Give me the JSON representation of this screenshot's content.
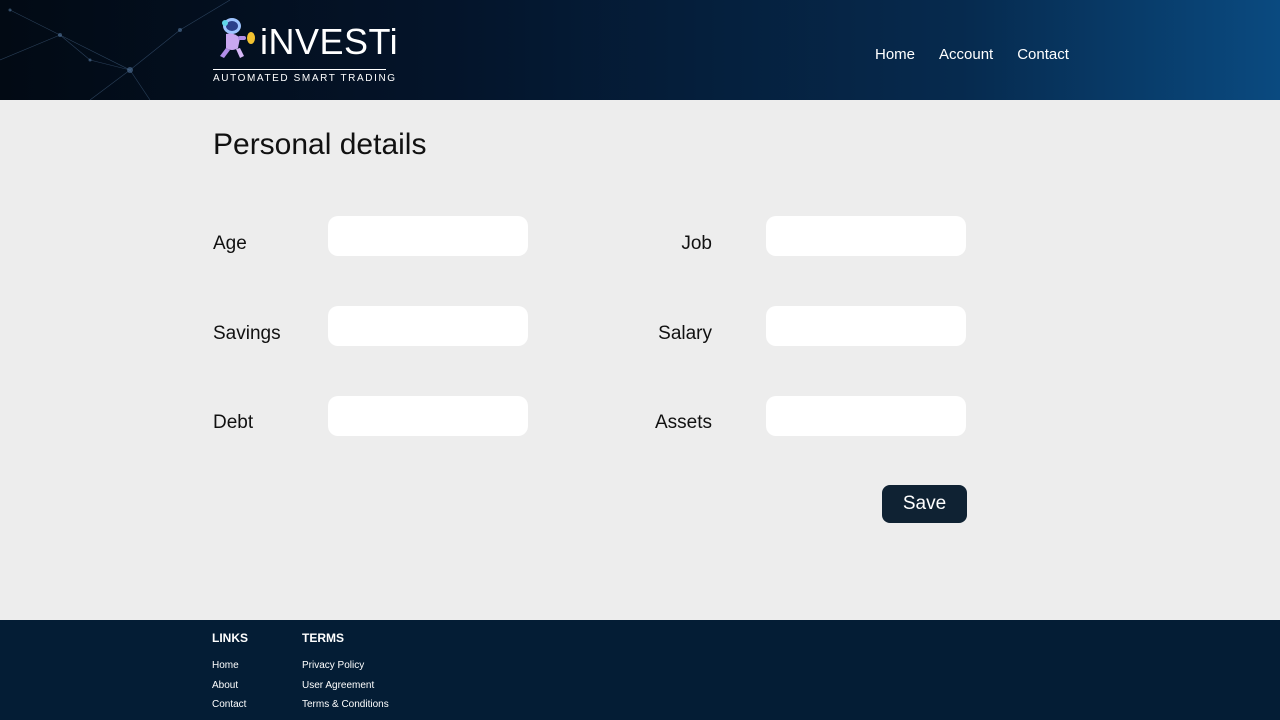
{
  "header": {
    "brand": "iNVESTi",
    "tagline": "AUTOMATED SMART TRADING",
    "nav": [
      "Home",
      "Account",
      "Contact"
    ]
  },
  "main": {
    "title": "Personal details",
    "fields": {
      "age": {
        "label": "Age",
        "value": ""
      },
      "job": {
        "label": "Job",
        "value": ""
      },
      "savings": {
        "label": "Savings",
        "value": ""
      },
      "salary": {
        "label": "Salary",
        "value": ""
      },
      "debt": {
        "label": "Debt",
        "value": ""
      },
      "assets": {
        "label": "Assets",
        "value": ""
      }
    },
    "save_label": "Save"
  },
  "footer": {
    "links": {
      "heading": "LINKS",
      "items": [
        "Home",
        "About",
        "Contact"
      ]
    },
    "terms": {
      "heading": "TERMS",
      "items": [
        "Privacy Policy",
        "User Agreement",
        "Terms & Conditions"
      ]
    }
  },
  "colors": {
    "header_dark": "#020a14",
    "header_light": "#0a4a80",
    "footer_bg": "#041d35",
    "button_bg": "#0f2233",
    "page_bg": "#ededed"
  }
}
